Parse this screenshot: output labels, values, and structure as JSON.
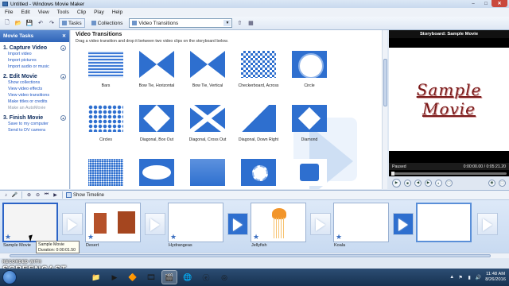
{
  "window": {
    "title": "Untitled - Windows Movie Maker",
    "min": "–",
    "max": "□",
    "close": "✕"
  },
  "menu": [
    "File",
    "Edit",
    "View",
    "Tools",
    "Clip",
    "Play",
    "Help"
  ],
  "toolbar": {
    "tasks_label": "Tasks",
    "collections_label": "Collections",
    "collection_select": "Video Transitions"
  },
  "tasks_pane": {
    "header": "Movie Tasks",
    "sections": [
      {
        "number": "1.",
        "title": "Capture Video",
        "links": [
          "Import video",
          "Import pictures",
          "Import audio or music"
        ],
        "dim": [
          false,
          false,
          false
        ]
      },
      {
        "number": "2.",
        "title": "Edit Movie",
        "links": [
          "Show collections",
          "View video effects",
          "View video transitions",
          "Make titles or credits",
          "Make an AutoMovie"
        ],
        "dim": [
          false,
          false,
          false,
          false,
          true
        ]
      },
      {
        "number": "3.",
        "title": "Finish Movie",
        "links": [
          "Save to my computer",
          "Send to DV camera"
        ],
        "dim": [
          false,
          false
        ]
      }
    ]
  },
  "transitions": {
    "title": "Video Transitions",
    "description": "Drag a video transition and drop it between two video clips on the storyboard below.",
    "items": [
      {
        "label": "Bars",
        "icon": "bars"
      },
      {
        "label": "Bow Tie, Horizontal",
        "icon": "bowtie-h"
      },
      {
        "label": "Bow Tie, Vertical",
        "icon": "bowtie-v"
      },
      {
        "label": "Checkerboard, Across",
        "icon": "checker"
      },
      {
        "label": "Circle",
        "icon": "circle"
      },
      {
        "label": "Circles",
        "icon": "circles"
      },
      {
        "label": "Diagonal, Box Out",
        "icon": "diag-box"
      },
      {
        "label": "Diagonal, Cross Out",
        "icon": "diag-cross"
      },
      {
        "label": "Diagonal, Down Right",
        "icon": "diag-down"
      },
      {
        "label": "Diamond",
        "icon": "diamond"
      },
      {
        "label": "",
        "icon": "dissolve"
      },
      {
        "label": "",
        "icon": "eye"
      },
      {
        "label": "",
        "icon": "fade"
      },
      {
        "label": "",
        "icon": "filmage"
      },
      {
        "label": "",
        "icon": "flip"
      }
    ]
  },
  "monitor": {
    "title": "Storyboard: Sample Movie",
    "video_line1": "Sample",
    "video_line2": "Movie",
    "status": "Paused",
    "time": "0:00:00.00 / 0:05:21.20",
    "seek_fraction": 0
  },
  "storyboard": {
    "show_timeline_label": "Show Timeline",
    "clips": [
      {
        "name": "Sample Movie",
        "scene": "blank",
        "selected": true
      },
      {
        "name": "Desert",
        "scene": "desert"
      },
      {
        "name": "Hydrangeas",
        "scene": "hydrangea"
      },
      {
        "name": "Jellyfish",
        "scene": "jelly"
      },
      {
        "name": "Koala",
        "scene": "koala"
      },
      {
        "name": "",
        "scene": "empty"
      }
    ],
    "transition_filled": [
      false,
      false,
      true,
      false,
      true
    ],
    "tooltip_title": "Sample Movie",
    "tooltip_duration": "Duration: 0:00:01.50"
  },
  "watermark": {
    "recorded_with": "RECORDED WITH",
    "brand": "SCREENCAST  MATIC"
  },
  "taskbar": {
    "apps": [
      "folder-icon",
      "media-player-icon",
      "vlc-icon",
      "film-icon",
      "movie-maker-icon",
      "chrome-icon",
      "ie-icon",
      "rec-icon"
    ],
    "clock_time": "11:48 AM",
    "clock_date": "8/26/2016"
  },
  "colors": {
    "accent_blue": "#2e6fcf",
    "title_text": "#7a1919"
  }
}
